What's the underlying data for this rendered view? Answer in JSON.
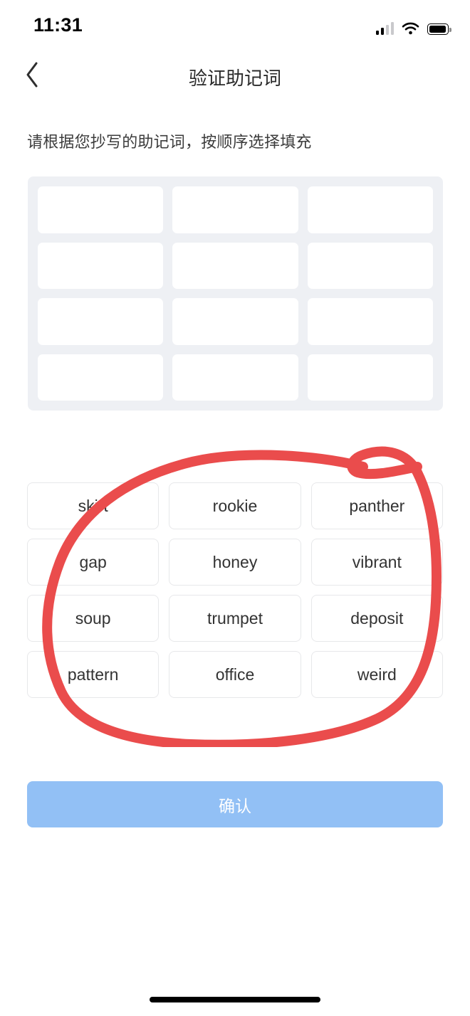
{
  "status_bar": {
    "time": "11:31",
    "signal_icon": "cellular-signal-icon",
    "wifi_icon": "wifi-icon",
    "battery_icon": "battery-full-icon"
  },
  "nav": {
    "back_icon": "chevron-left-icon",
    "title": "验证助记词"
  },
  "instruction": "请根据您抄写的助记词，按顺序选择填充",
  "slots": {
    "count": 12,
    "values": [
      "",
      "",
      "",
      "",
      "",
      "",
      "",
      "",
      "",
      "",
      "",
      ""
    ]
  },
  "word_bank": {
    "words": [
      "skirt",
      "rookie",
      "panther",
      "gap",
      "honey",
      "vibrant",
      "soup",
      "trumpet",
      "deposit",
      "pattern",
      "office",
      "weird"
    ]
  },
  "confirm_button": {
    "label": "确认"
  },
  "annotation": {
    "type": "hand-drawn-circle",
    "color": "#ea4c4c",
    "target": "word-bank"
  },
  "colors": {
    "panel_background": "#eef0f4",
    "chip_background": "#ffffff",
    "chip_border": "#e7e8ea",
    "confirm_blue": "#92c0f5",
    "annotation_red": "#ea4c4c",
    "title_text": "#2b2b2b",
    "body_text": "#3c3c3c"
  }
}
